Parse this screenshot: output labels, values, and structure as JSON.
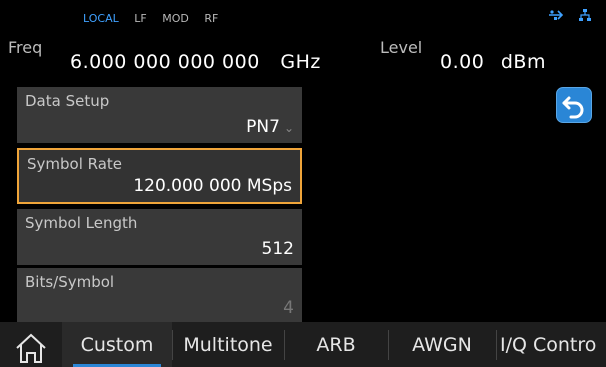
{
  "status": {
    "local": "LOCAL",
    "lf": "LF",
    "mod": "MOD",
    "rf": "RF"
  },
  "header": {
    "freq_label": "Freq",
    "freq_value": "6.000 000 000 000",
    "freq_unit": "GHz",
    "level_label": "Level",
    "level_value": "0.00",
    "level_unit": "dBm"
  },
  "settings": [
    {
      "label": "Data Setup",
      "value": "PN7"
    },
    {
      "label": "Symbol Rate",
      "value": "120.000 000 MSps"
    },
    {
      "label": "Symbol Length",
      "value": "512"
    },
    {
      "label": "Bits/Symbol",
      "value": "4"
    }
  ],
  "tabs": [
    {
      "label": "Custom",
      "selected": true
    },
    {
      "label": "Multitone"
    },
    {
      "label": "ARB"
    },
    {
      "label": "AWGN"
    },
    {
      "label": "I/Q Contro"
    }
  ],
  "colors": {
    "accent": "#2a86d6",
    "focus": "#f0a53a",
    "status_local": "#3fa1ff"
  },
  "icons": [
    "usb-icon",
    "network-icon",
    "back-icon",
    "home-icon"
  ]
}
